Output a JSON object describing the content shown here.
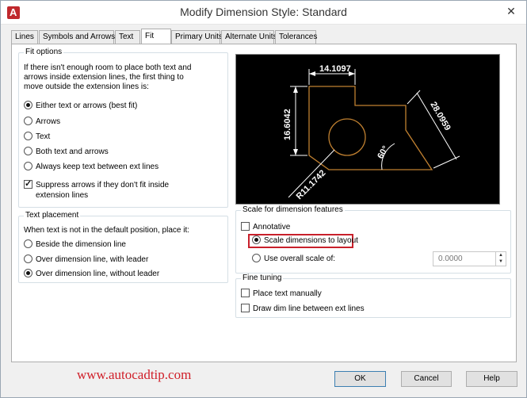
{
  "window": {
    "title": "Modify Dimension Style: Standard",
    "close_glyph": "✕"
  },
  "tabs": [
    {
      "label": "Lines"
    },
    {
      "label": "Symbols and Arrows"
    },
    {
      "label": "Text"
    },
    {
      "label": "Fit",
      "active": true
    },
    {
      "label": "Primary Units"
    },
    {
      "label": "Alternate Units"
    },
    {
      "label": "Tolerances"
    }
  ],
  "fit_options": {
    "title": "Fit options",
    "description": [
      "If there isn't enough room to place both text and",
      "arrows inside extension lines, the first thing to",
      "move outside the extension lines is:"
    ],
    "choices": [
      {
        "label": "Either text or arrows (best fit)",
        "selected": true
      },
      {
        "label": "Arrows",
        "selected": false
      },
      {
        "label": "Text",
        "selected": false
      },
      {
        "label": "Both text and arrows",
        "selected": false
      },
      {
        "label": "Always keep text between ext lines",
        "selected": false
      }
    ],
    "suppress": {
      "lines": [
        "Suppress arrows if they don't fit inside",
        "extension lines"
      ],
      "checked": true
    }
  },
  "text_placement": {
    "title": "Text placement",
    "description": "When text is not in the default position, place it:",
    "choices": [
      {
        "label": "Beside the dimension line",
        "selected": false
      },
      {
        "label": "Over dimension line, with leader",
        "selected": false
      },
      {
        "label": "Over dimension line, without leader",
        "selected": true
      }
    ]
  },
  "preview": {
    "dims": {
      "top": "14.1097",
      "left": "16.6042",
      "right": "28.0959",
      "angle": "60°",
      "radius": "R11.1742"
    },
    "colors": {
      "background": "#000000",
      "geometry": "#c08030",
      "dimensions": "#ffffff"
    }
  },
  "scale": {
    "title": "Scale for dimension features",
    "annotative": {
      "label": "Annotative",
      "checked": false
    },
    "layout": {
      "label": "Scale dimensions to layout",
      "selected": true
    },
    "overall": {
      "label": "Use overall scale of:",
      "selected": false,
      "value": "0.0000"
    }
  },
  "fine_tuning": {
    "title": "Fine tuning",
    "place_manual": {
      "label": "Place text manually",
      "checked": false
    },
    "draw_dim": {
      "label": "Draw dim line between ext lines",
      "checked": false
    }
  },
  "footer": {
    "watermark": "www.autocadtip.com",
    "ok": "OK",
    "cancel": "Cancel",
    "help": "Help"
  },
  "colors": {
    "highlight": "#c8202b",
    "watermark": "#d0202a"
  }
}
